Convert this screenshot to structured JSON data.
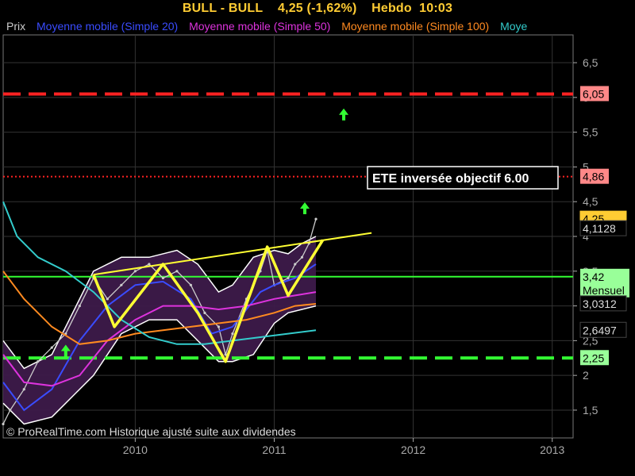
{
  "header": {
    "symbol": "BULL - BULL",
    "price": "4,25 (-1,62%)",
    "period": "Hebdo",
    "time": "10:03"
  },
  "legend": [
    {
      "label": "Prix",
      "color": "#cccccc"
    },
    {
      "label": "Moyenne mobile (Simple 20)",
      "color": "#3a4cff"
    },
    {
      "label": "Moyenne mobile (Simple 50)",
      "color": "#dd33dd"
    },
    {
      "label": "Moyenne mobile (Simple 100)",
      "color": "#ff8a20"
    },
    {
      "label": "Moye",
      "color": "#33cccc"
    }
  ],
  "footer": "© ProRealTime.com Historique ajusté suite aux dividendes",
  "annotation": "ETE  inversée objectif 6.00",
  "colors": {
    "band_fill": "#3d1a4a",
    "band_edge": "#ffffff",
    "yellow": "#ffff33",
    "green": "#33ff33",
    "red": "#ff2222"
  },
  "chart_data": {
    "type": "line",
    "title": "BULL - BULL",
    "x_axis": {
      "ticks": [
        "2010",
        "2011",
        "2012",
        "2013"
      ],
      "tick_values": [
        2010,
        2011,
        2012,
        2013
      ],
      "range": [
        2009.05,
        2013.15
      ]
    },
    "y_axis": {
      "range": [
        1.1,
        6.9
      ],
      "ticks": [
        "1,5",
        "2",
        "2,5",
        "3",
        "3,5",
        "4",
        "4,5",
        "5",
        "5,5",
        "6",
        "6,5"
      ],
      "tick_values": [
        1.5,
        2,
        2.5,
        3,
        3.5,
        4,
        4.5,
        5,
        5.5,
        6,
        6.5
      ],
      "grid": true
    },
    "horizontal_levels": [
      {
        "name": "objective",
        "value": 6.05,
        "label": "6,05",
        "style": "dashed",
        "color": "#ff2222",
        "label_bg": "#ff8888"
      },
      {
        "name": "resistance",
        "value": 4.86,
        "label": "4,86",
        "style": "dotted",
        "color": "#ff2222",
        "label_bg": "#ff8888"
      },
      {
        "name": "monthly",
        "value": 3.42,
        "label": "3,42\nMensuel",
        "style": "solid",
        "color": "#33ff33",
        "label_bg": "#99ff99"
      },
      {
        "name": "support",
        "value": 2.25,
        "label": "2,25",
        "style": "dashed",
        "color": "#33ff33",
        "label_bg": "#99ff99"
      }
    ],
    "value_labels": [
      {
        "value": 4.25,
        "label": "4,25",
        "bg": "#ffcc33",
        "fg": "#000000"
      },
      {
        "value": 4.1128,
        "label": "4,1128",
        "bg": "#000000",
        "fg": "#dddddd"
      },
      {
        "value": 3.0312,
        "label": "3,0312",
        "bg": "#000000",
        "fg": "#dddddd"
      },
      {
        "value": 2.6497,
        "label": "2,6497",
        "bg": "#000000",
        "fg": "#dddddd"
      }
    ],
    "series": [
      {
        "name": "Prix",
        "color": "#cccccc",
        "points": [
          [
            2009.05,
            1.3
          ],
          [
            2009.1,
            1.5
          ],
          [
            2009.2,
            1.8
          ],
          [
            2009.3,
            2.2
          ],
          [
            2009.4,
            2.4
          ],
          [
            2009.5,
            2.6
          ],
          [
            2009.6,
            3.0
          ],
          [
            2009.7,
            3.4
          ],
          [
            2009.8,
            3.1
          ],
          [
            2009.9,
            3.3
          ],
          [
            2010.0,
            3.5
          ],
          [
            2010.1,
            3.6
          ],
          [
            2010.2,
            3.4
          ],
          [
            2010.3,
            3.5
          ],
          [
            2010.4,
            3.3
          ],
          [
            2010.5,
            2.9
          ],
          [
            2010.6,
            2.7
          ],
          [
            2010.65,
            2.3
          ],
          [
            2010.7,
            2.6
          ],
          [
            2010.8,
            3.1
          ],
          [
            2010.9,
            3.5
          ],
          [
            2010.95,
            3.8
          ],
          [
            2011.0,
            3.3
          ],
          [
            2011.1,
            3.4
          ],
          [
            2011.15,
            3.6
          ],
          [
            2011.2,
            3.7
          ],
          [
            2011.25,
            3.9
          ],
          [
            2011.3,
            4.25
          ]
        ]
      },
      {
        "name": "Moyenne mobile (Simple 20)",
        "color": "#3a4cff",
        "points": [
          [
            2009.05,
            1.9
          ],
          [
            2009.2,
            1.5
          ],
          [
            2009.4,
            1.8
          ],
          [
            2009.6,
            2.5
          ],
          [
            2009.8,
            3.0
          ],
          [
            2010.0,
            3.3
          ],
          [
            2010.2,
            3.35
          ],
          [
            2010.4,
            3.1
          ],
          [
            2010.55,
            2.6
          ],
          [
            2010.7,
            2.7
          ],
          [
            2010.9,
            3.2
          ],
          [
            2011.0,
            3.3
          ],
          [
            2011.15,
            3.4
          ],
          [
            2011.3,
            3.6
          ]
        ]
      },
      {
        "name": "Moyenne mobile (Simple 50)",
        "color": "#dd33dd",
        "points": [
          [
            2009.05,
            2.3
          ],
          [
            2009.2,
            1.9
          ],
          [
            2009.4,
            1.85
          ],
          [
            2009.6,
            2.0
          ],
          [
            2009.8,
            2.5
          ],
          [
            2010.0,
            2.8
          ],
          [
            2010.2,
            3.0
          ],
          [
            2010.4,
            3.0
          ],
          [
            2010.6,
            2.95
          ],
          [
            2010.8,
            3.0
          ],
          [
            2011.0,
            3.1
          ],
          [
            2011.15,
            3.15
          ],
          [
            2011.3,
            3.2
          ]
        ]
      },
      {
        "name": "Moyenne mobile (Simple 100)",
        "color": "#ff8a20",
        "points": [
          [
            2009.05,
            3.5
          ],
          [
            2009.2,
            3.1
          ],
          [
            2009.4,
            2.7
          ],
          [
            2009.6,
            2.45
          ],
          [
            2009.8,
            2.5
          ],
          [
            2010.0,
            2.6
          ],
          [
            2010.2,
            2.65
          ],
          [
            2010.4,
            2.7
          ],
          [
            2010.6,
            2.75
          ],
          [
            2010.8,
            2.8
          ],
          [
            2011.0,
            2.9
          ],
          [
            2011.15,
            3.0
          ],
          [
            2011.3,
            3.03
          ]
        ]
      },
      {
        "name": "Moye",
        "color": "#33cccc",
        "points": [
          [
            2009.05,
            4.5
          ],
          [
            2009.15,
            4.0
          ],
          [
            2009.3,
            3.7
          ],
          [
            2009.5,
            3.5
          ],
          [
            2009.7,
            3.2
          ],
          [
            2009.9,
            2.8
          ],
          [
            2010.1,
            2.55
          ],
          [
            2010.3,
            2.45
          ],
          [
            2010.5,
            2.45
          ],
          [
            2010.7,
            2.5
          ],
          [
            2010.9,
            2.55
          ],
          [
            2011.1,
            2.6
          ],
          [
            2011.3,
            2.65
          ]
        ]
      }
    ],
    "band": {
      "upper": [
        [
          2009.05,
          2.5
        ],
        [
          2009.2,
          2.1
        ],
        [
          2009.4,
          2.3
        ],
        [
          2009.55,
          2.9
        ],
        [
          2009.7,
          3.5
        ],
        [
          2009.9,
          3.7
        ],
        [
          2010.1,
          3.7
        ],
        [
          2010.3,
          3.8
        ],
        [
          2010.45,
          3.6
        ],
        [
          2010.6,
          3.2
        ],
        [
          2010.7,
          3.3
        ],
        [
          2010.85,
          3.7
        ],
        [
          2011.0,
          3.8
        ],
        [
          2011.1,
          3.75
        ],
        [
          2011.2,
          3.9
        ],
        [
          2011.3,
          4.0
        ]
      ],
      "lower": [
        [
          2009.05,
          1.6
        ],
        [
          2009.2,
          1.3
        ],
        [
          2009.4,
          1.4
        ],
        [
          2009.55,
          1.7
        ],
        [
          2009.7,
          2.0
        ],
        [
          2009.9,
          2.6
        ],
        [
          2010.1,
          2.8
        ],
        [
          2010.3,
          2.8
        ],
        [
          2010.45,
          2.5
        ],
        [
          2010.6,
          2.2
        ],
        [
          2010.7,
          2.2
        ],
        [
          2010.85,
          2.3
        ],
        [
          2011.0,
          2.75
        ],
        [
          2011.1,
          2.9
        ],
        [
          2011.2,
          2.95
        ],
        [
          2011.3,
          3.0
        ]
      ]
    },
    "pattern_lines": [
      {
        "name": "neckline",
        "points": [
          [
            2009.7,
            3.45
          ],
          [
            2011.7,
            4.05
          ]
        ]
      },
      {
        "name": "head-and-shoulders",
        "points": [
          [
            2009.7,
            3.45
          ],
          [
            2009.85,
            2.7
          ],
          [
            2010.2,
            3.6
          ],
          [
            2010.45,
            2.9
          ],
          [
            2010.65,
            2.2
          ],
          [
            2010.95,
            3.85
          ],
          [
            2011.1,
            3.15
          ],
          [
            2011.35,
            3.95
          ]
        ]
      }
    ],
    "markers": [
      {
        "type": "up-arrow",
        "x": 2009.5,
        "y": 2.35
      },
      {
        "type": "up-arrow",
        "x": 2011.22,
        "y": 4.4
      },
      {
        "type": "up-arrow",
        "x": 2011.5,
        "y": 5.75
      }
    ]
  }
}
